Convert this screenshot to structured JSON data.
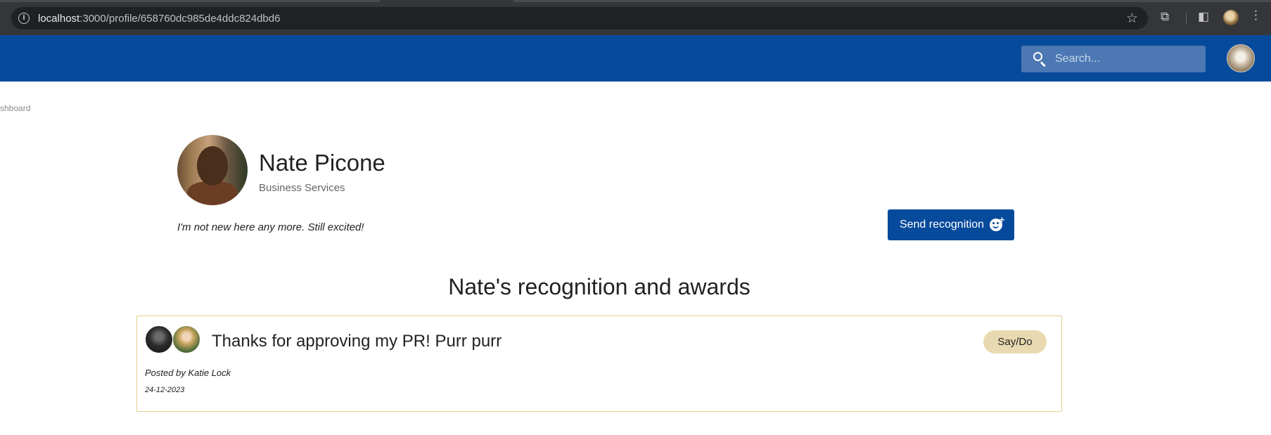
{
  "browser": {
    "url_host": "localhost",
    "url_path": ":3000/profile/658760dc985de4ddc824dbd6"
  },
  "header": {
    "search_placeholder": "Search..."
  },
  "breadcrumb": "shboard",
  "profile": {
    "name": "Nate Picone",
    "department": "Business Services",
    "tagline": "I'm not new here any more. Still excited!",
    "send_button_label": "Send recognition"
  },
  "recognition_section": {
    "title": "Nate's recognition and awards",
    "items": [
      {
        "message": "Thanks for approving my PR! Purr purr",
        "badge": "Say/Do",
        "posted_by": "Posted by Katie Lock",
        "date": "24-12-2023"
      }
    ]
  },
  "colors": {
    "brand_blue": "#064a9b",
    "card_border": "#e3cf8e",
    "badge_bg": "#e8d9b0"
  },
  "icons": [
    "info-icon",
    "star-icon",
    "extensions-icon",
    "side-panel-icon",
    "profile-icon",
    "more-icon",
    "search-icon",
    "smile-plus-icon"
  ]
}
